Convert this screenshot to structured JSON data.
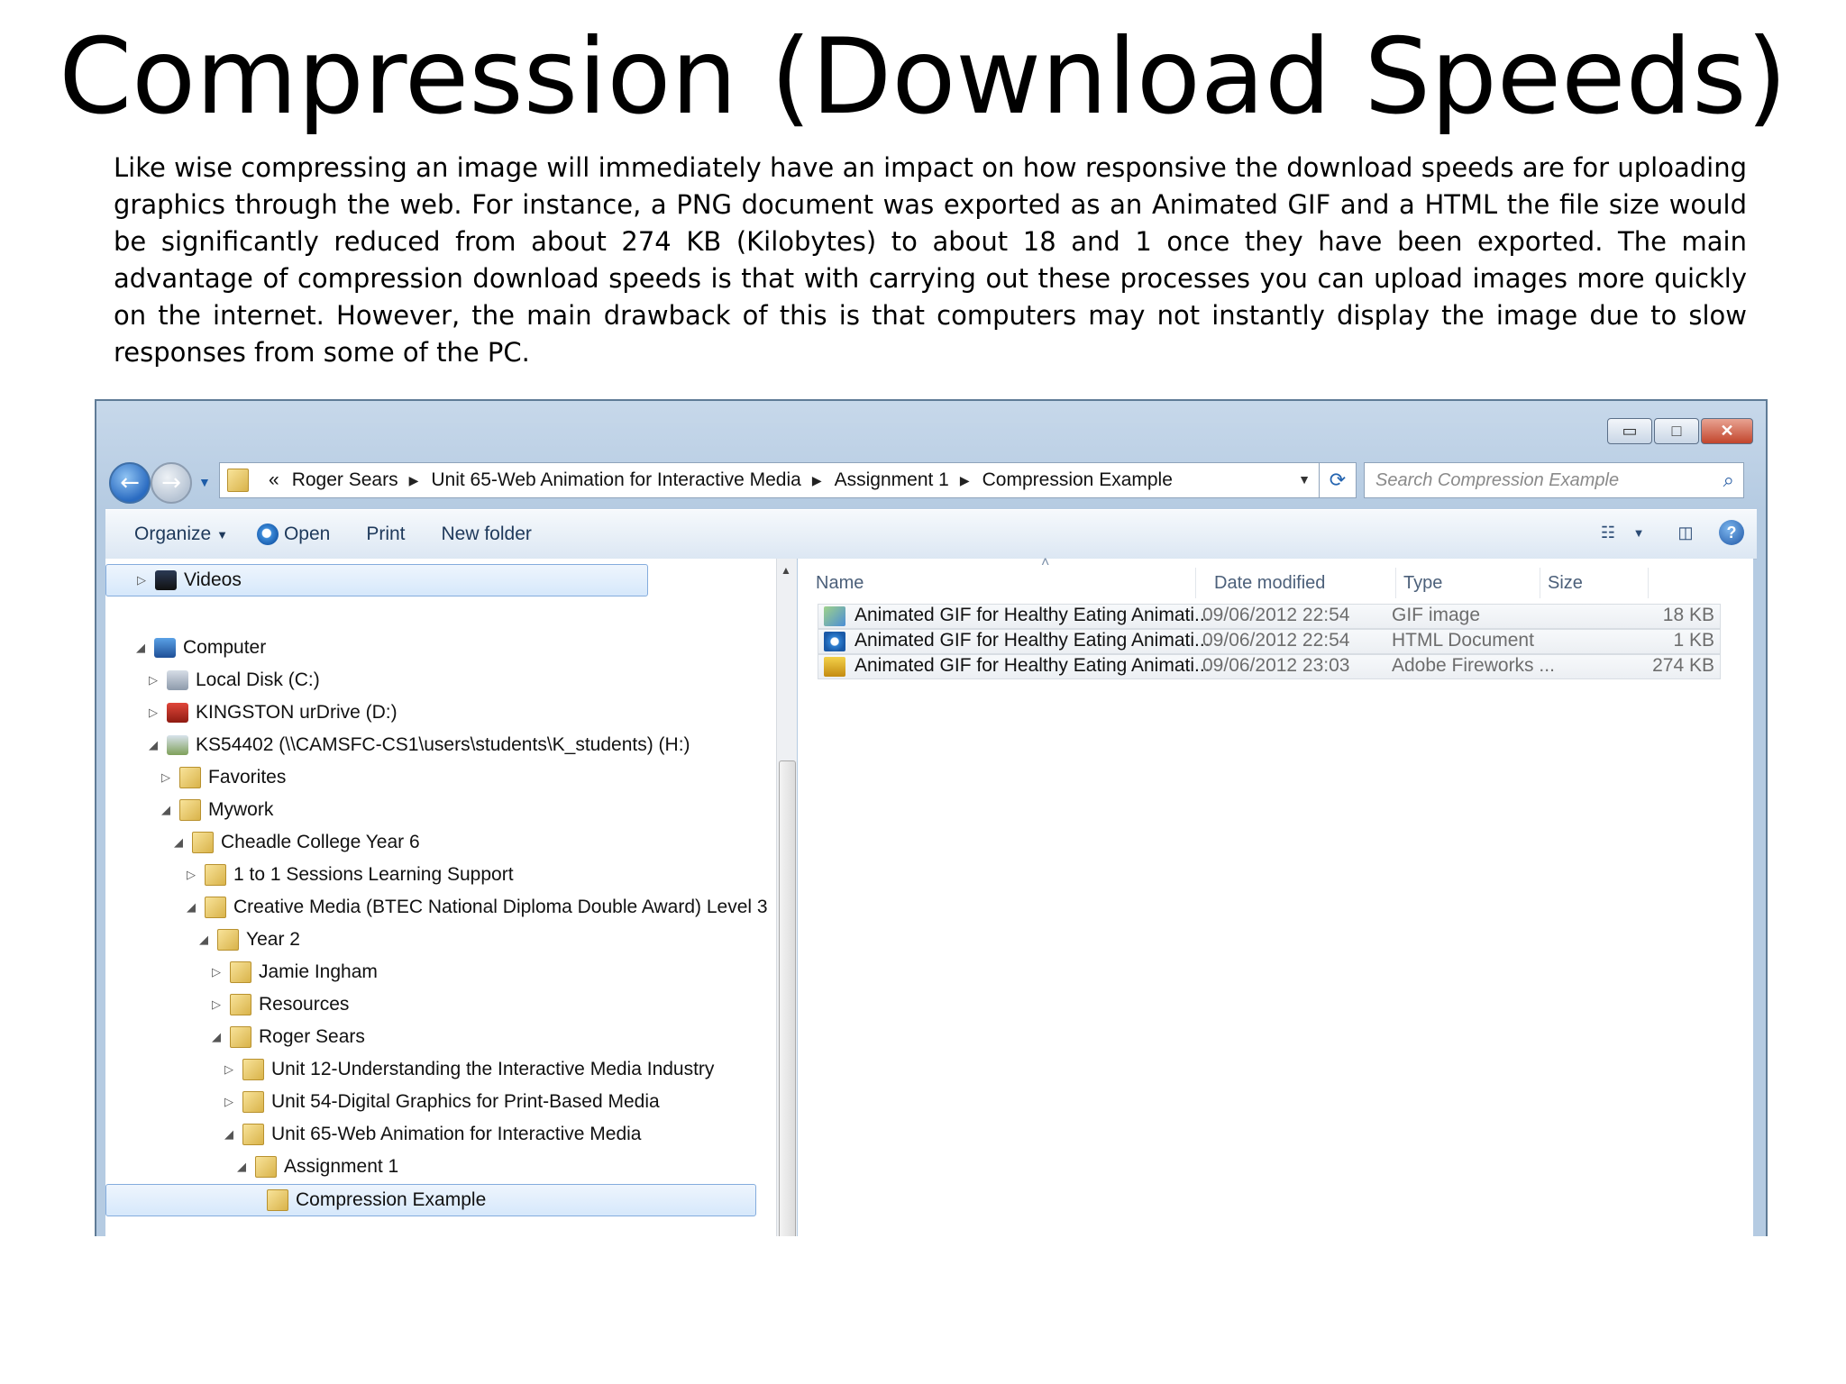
{
  "slide": {
    "title": "Compression (Download Speeds)",
    "body": "Like wise compressing an image will immediately have an impact on how responsive the download speeds are for uploading graphics through the web. For instance, a PNG document was exported as an Animated GIF and a HTML the file size would be significantly reduced from about 274 KB (Kilobytes) to about 18 and 1 once they have been exported. The main advantage of compression download speeds is that with carrying out these processes you can upload images more quickly on the internet. However, the main drawback of this is that computers may not instantly display the image due to slow responses from some of the PC."
  },
  "window": {
    "caption_buttons": {
      "minimize": "▭",
      "maximize": "□",
      "close": "✕"
    },
    "address": {
      "overflow": "«",
      "crumbs": [
        "Roger Sears",
        "Unit 65-Web Animation for Interactive Media",
        "Assignment 1",
        "Compression Example"
      ]
    },
    "search_placeholder": "Search Compression Example",
    "toolbar": {
      "organize": "Organize",
      "open": "Open",
      "print": "Print",
      "new_folder": "New folder"
    },
    "icons": {
      "back": "back-arrow-icon",
      "forward": "forward-arrow-icon",
      "refresh": "refresh-icon",
      "search": "search-icon",
      "views": "views-icon",
      "preview": "preview-pane-icon",
      "help": "help-icon"
    }
  },
  "tree": [
    {
      "label": "Videos",
      "icon": "video-icon",
      "expander": "▷",
      "highlight": true
    },
    {
      "label": "Computer",
      "icon": "computer-icon",
      "expander": "◢"
    },
    {
      "label": "Local Disk (C:)",
      "icon": "drive-icon",
      "expander": "▷"
    },
    {
      "label": "KINGSTON urDrive (D:)",
      "icon": "usb-drive-icon",
      "expander": "▷"
    },
    {
      "label": "KS54402 (\\\\CAMSFC-CS1\\users\\students\\K_students) (H:)",
      "icon": "network-drive-icon",
      "expander": "◢"
    },
    {
      "label": "Favorites",
      "icon": "folder-icon",
      "expander": "▷"
    },
    {
      "label": "Mywork",
      "icon": "folder-icon",
      "expander": "◢"
    },
    {
      "label": "Cheadle College Year 6",
      "icon": "folder-icon",
      "expander": "◢"
    },
    {
      "label": "1 to 1 Sessions Learning Support",
      "icon": "folder-icon",
      "expander": "▷"
    },
    {
      "label": "Creative Media (BTEC National Diploma Double Award) Level 3",
      "icon": "folder-icon",
      "expander": "◢"
    },
    {
      "label": "Year 2",
      "icon": "folder-icon",
      "expander": "◢"
    },
    {
      "label": "Jamie Ingham",
      "icon": "folder-icon",
      "expander": "▷"
    },
    {
      "label": "Resources",
      "icon": "folder-icon",
      "expander": "▷"
    },
    {
      "label": "Roger Sears",
      "icon": "folder-icon",
      "expander": "◢"
    },
    {
      "label": "Unit 12-Understanding the Interactive Media Industry",
      "icon": "folder-icon",
      "expander": "▷"
    },
    {
      "label": "Unit 54-Digital Graphics for Print-Based Media",
      "icon": "folder-icon",
      "expander": "▷"
    },
    {
      "label": "Unit 65-Web Animation for Interactive Media",
      "icon": "folder-icon",
      "expander": "◢"
    },
    {
      "label": "Assignment 1",
      "icon": "folder-icon",
      "expander": "◢"
    },
    {
      "label": "Compression Example",
      "icon": "folder-icon",
      "expander": "",
      "selected": true
    }
  ],
  "files": {
    "columns": [
      "Name",
      "Date modified",
      "Type",
      "Size"
    ],
    "rows": [
      {
        "name": "Animated GIF for Healthy Eating Animati...",
        "date": "09/06/2012 22:54",
        "type": "GIF image",
        "size": "18 KB",
        "icon": "gif-image-icon"
      },
      {
        "name": "Animated GIF for Healthy Eating Animati...",
        "date": "09/06/2012 22:54",
        "type": "HTML Document",
        "size": "1 KB",
        "icon": "html-document-icon"
      },
      {
        "name": "Animated GIF for Healthy Eating Animati...",
        "date": "09/06/2012 23:03",
        "type": "Adobe Fireworks ...",
        "size": "274 KB",
        "icon": "fireworks-file-icon"
      }
    ]
  }
}
